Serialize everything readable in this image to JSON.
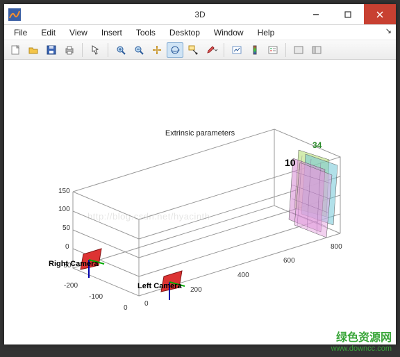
{
  "window": {
    "title": "3D"
  },
  "menu": {
    "items": [
      "File",
      "Edit",
      "View",
      "Insert",
      "Tools",
      "Desktop",
      "Window",
      "Help"
    ],
    "rt_glyph": "↘"
  },
  "toolbar": {
    "icons": [
      {
        "name": "new-figure-icon",
        "title": "New Figure"
      },
      {
        "name": "open-icon",
        "title": "Open"
      },
      {
        "name": "save-icon",
        "title": "Save"
      },
      {
        "name": "print-icon",
        "title": "Print"
      }
    ],
    "icons2": [
      {
        "name": "pointer-icon",
        "title": "Edit Plot"
      }
    ],
    "icons3": [
      {
        "name": "zoom-in-icon",
        "title": "Zoom In"
      },
      {
        "name": "zoom-out-icon",
        "title": "Zoom Out"
      },
      {
        "name": "pan-icon",
        "title": "Pan"
      },
      {
        "name": "rotate3d-icon",
        "title": "Rotate 3D",
        "active": true
      },
      {
        "name": "data-cursor-icon",
        "title": "Data Cursor"
      },
      {
        "name": "brush-icon",
        "title": "Brush"
      }
    ],
    "icons4": [
      {
        "name": "link-icon",
        "title": "Link Plot"
      },
      {
        "name": "colorbar-icon",
        "title": "Insert Colorbar"
      },
      {
        "name": "legend-icon",
        "title": "Insert Legend"
      }
    ],
    "icons5": [
      {
        "name": "hide-tools-icon",
        "title": "Hide Plot Tools"
      },
      {
        "name": "show-tools-icon",
        "title": "Show Plot Tools"
      }
    ]
  },
  "chart_data": {
    "type": "other",
    "title": "Extrinsic parameters",
    "watermark": "http://blog.csdn.net/hyacinth",
    "x_ticks": [
      0,
      200,
      400,
      600,
      800
    ],
    "y_ticks": [
      -200,
      -100,
      0
    ],
    "z_ticks": [
      -50,
      0,
      50,
      100,
      150
    ],
    "cameras": [
      {
        "label": "Right Camera",
        "pos3d": [
          0,
          -15,
          0
        ]
      },
      {
        "label": "Left Camera",
        "pos3d": [
          0,
          130,
          0
        ]
      }
    ],
    "board_labels": [
      "10",
      "34"
    ]
  },
  "footer": {
    "line1_cn": "绿色资源网",
    "line2": "www.downcc.com"
  }
}
